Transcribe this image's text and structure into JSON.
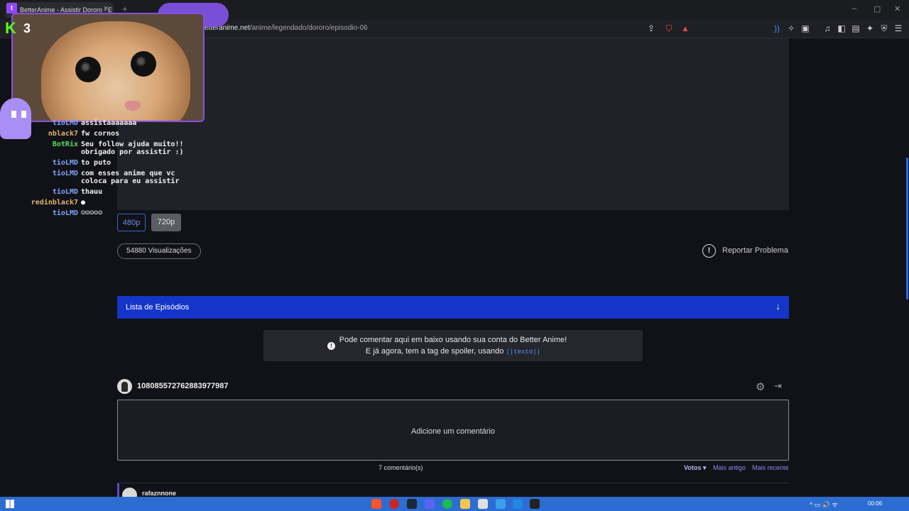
{
  "browser": {
    "tab_title": "BetterAnime - Assistir Dororo - E",
    "tab_close": "×",
    "new_tab": "+",
    "url_host": "etteranime.net",
    "url_path": "/anime/legendado/dororo/episodio-06",
    "window_controls": [
      "–",
      "▢",
      "✕"
    ]
  },
  "player": {
    "qualities": [
      "480p",
      "720p"
    ],
    "selected_quality": "720p"
  },
  "stats": {
    "views": "54880 Visualizações",
    "report_label": "Reportar Problema",
    "report_icon": "!"
  },
  "episodes": {
    "label": "Lista de Episódios",
    "arrow": "↓"
  },
  "notice": {
    "line1": "Pode comentar aqui em baixo usando sua conta do Better Anime!",
    "line2": "E já agora, tem a tag de spoiler, usando",
    "spoiler_tag": "||texto||",
    "icon": "!"
  },
  "comments": {
    "user_id": "1080855727628839779​87",
    "placeholder": "Adicione um comentário",
    "count": "7 comentário(s)",
    "sort_votes": "Votos ▾",
    "sort_old": "Mais antigo",
    "sort_new": "Mais recente",
    "first_user": "rafaznnone"
  },
  "overlay": {
    "viewer_count": "3",
    "twitch_label": "t",
    "kick_label": "K",
    "chat": [
      {
        "user": "tioLMD",
        "msg": "assistaaaaaaa",
        "color": "#7fa6ff"
      },
      {
        "user": "nblack7",
        "msg": "fw cornos",
        "color": "#e3b36a"
      },
      {
        "user": "BotRix",
        "msg": "Seu follow ajuda muito!! obrigado por assistir :)",
        "color": "#57e05a"
      },
      {
        "user": "tioLMD",
        "msg": "to puto",
        "color": "#7fa6ff"
      },
      {
        "user": "tioLMD",
        "msg": "com esses anime que vc coloca para eu assistir",
        "color": "#7fa6ff"
      },
      {
        "user": "tioLMD",
        "msg": "thauu",
        "color": "#7fa6ff"
      },
      {
        "user": "redinblack7",
        "msg": "●",
        "color": "#e3b36a"
      },
      {
        "user": "tioLMD",
        "msg": "☺☺☺☺☺",
        "color": "#7fa6ff"
      }
    ]
  },
  "taskbar": {
    "time": "00:06",
    "tray": "^  ▭  🔊  ᯤ"
  },
  "colors": {
    "accent_blue": "#1534c8",
    "link_purple": "#8f86ee",
    "taskbar": "#2d6dd1"
  }
}
